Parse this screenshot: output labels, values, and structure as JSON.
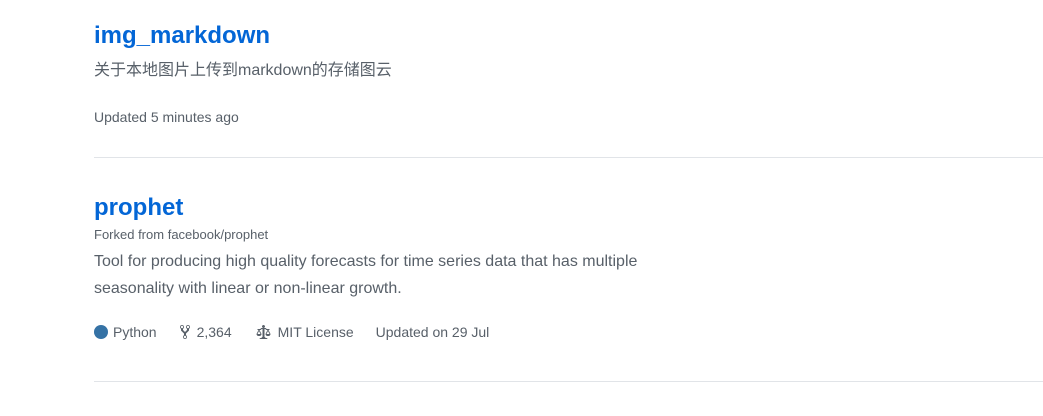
{
  "repos": [
    {
      "name": "img_markdown",
      "description": "关于本地图片上传到markdown的存储图云",
      "updated": "Updated 5 minutes ago"
    },
    {
      "name": "prophet",
      "forked_prefix": "Forked from",
      "forked_source": "facebook/prophet",
      "description": "Tool for producing high quality forecasts for time series data that has multiple seasonality with linear or non-linear growth.",
      "language": "Python",
      "language_color": "#3572A5",
      "forks": "2,364",
      "license": "MIT License",
      "updated": "Updated on 29 Jul",
      "icons": {
        "forks": "repo-forked-icon",
        "license": "law-icon"
      }
    }
  ]
}
